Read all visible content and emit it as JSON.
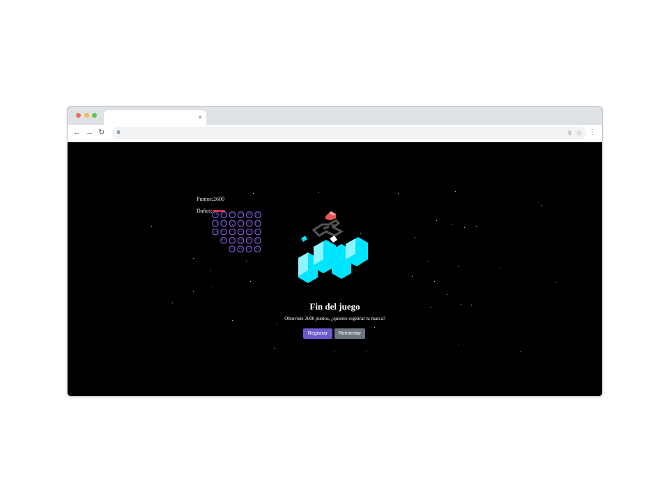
{
  "browser": {
    "tab_close_glyph": "×",
    "traffic_lights": [
      "#ed6a5e",
      "#f4bf4f",
      "#61c554"
    ],
    "icons": [
      "back-arrow-icon",
      "forward-arrow-icon",
      "reload-icon",
      "lock-icon",
      "share-icon",
      "bookmark-star-icon",
      "kebab-menu-icon"
    ]
  },
  "hud": {
    "score_label": "Puntos:",
    "score_value": "2600",
    "damage_label": "Daños:"
  },
  "invaders": {
    "rows": [
      6,
      6,
      6,
      5,
      4
    ],
    "color": "#7a5cd6"
  },
  "game_over": {
    "title": "Fin del juego",
    "message": "Obtuviste 2600 puntos, ¿quieres registrar tu marca?",
    "register_label": "Registrar",
    "restart_label": "Reintentar"
  },
  "colors": {
    "register_button": "#6a5acd",
    "restart_button": "#6c757d",
    "logo_cyan": "#00e5ff",
    "logo_red": "#e85555"
  }
}
